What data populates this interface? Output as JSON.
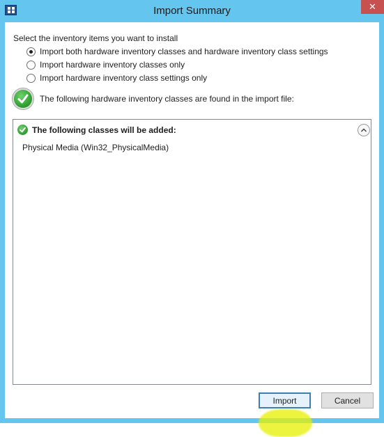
{
  "window": {
    "title": "Import Summary",
    "close_label": "✕",
    "colors": {
      "frame": "#64c6ee",
      "close": "#c75050",
      "highlight": "#e6f000"
    }
  },
  "options": {
    "instruction": "Select the inventory items you want to install",
    "radios": [
      {
        "label": "Import both hardware inventory classes and hardware inventory class settings",
        "checked": true
      },
      {
        "label": "Import hardware inventory classes only",
        "checked": false
      },
      {
        "label": "Import hardware inventory class settings only",
        "checked": false
      }
    ]
  },
  "status": {
    "icon": "green-check-icon",
    "text": "The following hardware inventory classes are found in the import file:"
  },
  "results": {
    "section_header": "The following classes will be added:",
    "items": [
      "Physical Media (Win32_PhysicalMedia)"
    ]
  },
  "buttons": {
    "import_label": "Import",
    "cancel_label": "Cancel"
  }
}
